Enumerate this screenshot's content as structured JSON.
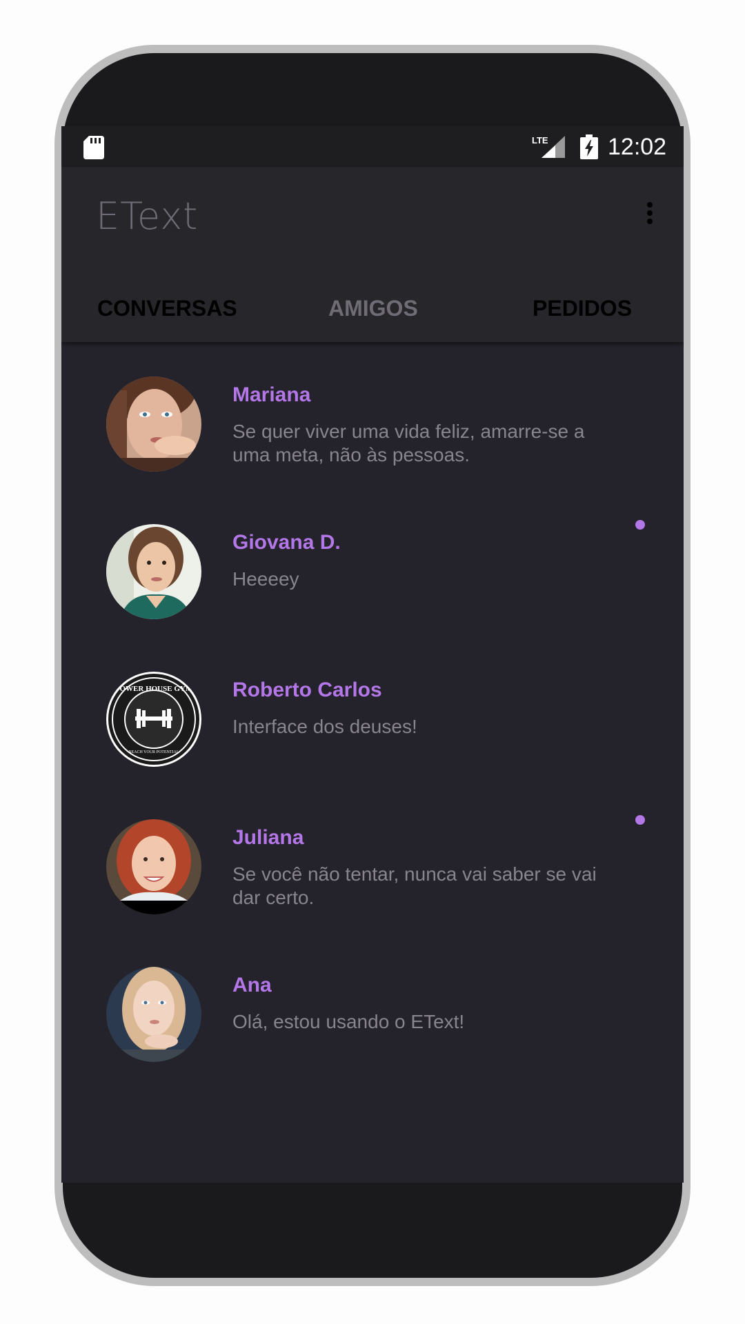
{
  "status_bar": {
    "time": "12:02",
    "network": "LTE",
    "icons": [
      "sd-card-icon",
      "lte-signal-icon",
      "battery-charging-icon"
    ]
  },
  "app_bar": {
    "title": "EText",
    "menu_icon": "overflow-menu-icon"
  },
  "tabs": [
    {
      "label": "CONVERSAS",
      "selected": true
    },
    {
      "label": "AMIGOS",
      "selected": false
    },
    {
      "label": "PEDIDOS",
      "selected": false
    }
  ],
  "conversations": [
    {
      "name": "Mariana",
      "message": "Se quer viver uma vida feliz, amarre-se a uma meta, não às pessoas.",
      "unread": false
    },
    {
      "name": "Giovana D.",
      "message": "Heeeey",
      "unread": true
    },
    {
      "name": "Roberto Carlos",
      "message": "Interface dos deuses!",
      "unread": false,
      "avatar_text": "POWER HOUSE GYM",
      "avatar_subtext": "REACH YOUR POTENTIAL"
    },
    {
      "name": "Juliana",
      "message": "Se você não tentar, nunca vai saber se vai dar certo.",
      "unread": true
    },
    {
      "name": "Ana",
      "message": "Olá, estou usando o EText!",
      "unread": false
    }
  ],
  "colors": {
    "accent": "#b477e8",
    "background": "#24222a",
    "app_bar": "#27262b",
    "status_bar": "#1e1e21",
    "message_text": "#88858e"
  }
}
